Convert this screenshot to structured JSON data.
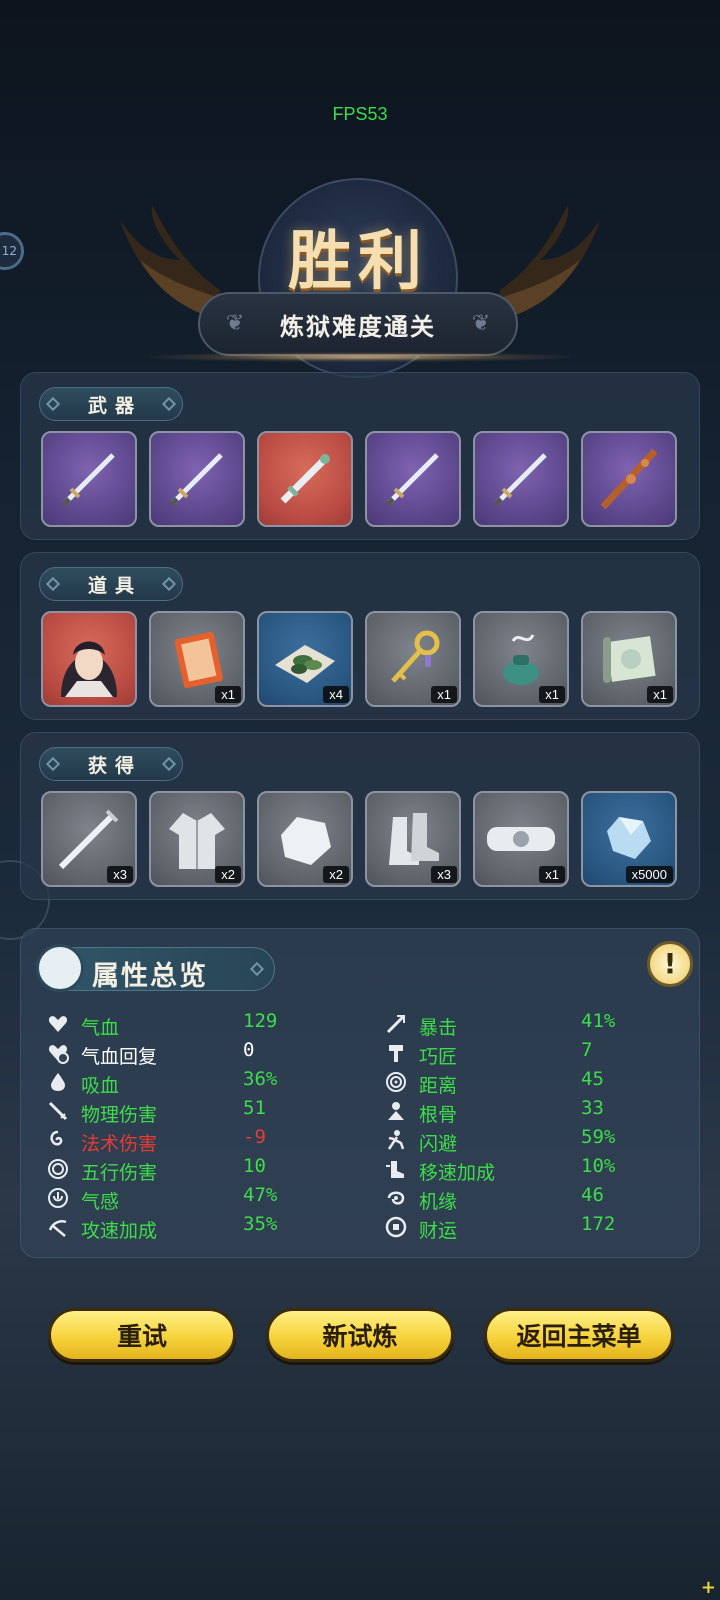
{
  "fps": "FPS53",
  "side_badge": "12",
  "victory": {
    "title": "胜利",
    "subtitle": "炼狱难度通关"
  },
  "weapons": {
    "label": "武器",
    "items": [
      {
        "icon": "silver-sword-icon",
        "rarity": "purple"
      },
      {
        "icon": "silver-sword-icon",
        "rarity": "purple"
      },
      {
        "icon": "jade-hilt-sword-icon",
        "rarity": "red"
      },
      {
        "icon": "silver-sword-icon",
        "rarity": "purple"
      },
      {
        "icon": "silver-sword-icon",
        "rarity": "purple"
      },
      {
        "icon": "bronze-staff-icon",
        "rarity": "purple"
      }
    ]
  },
  "props": {
    "label": "道具",
    "items": [
      {
        "icon": "character-portrait-icon",
        "rarity": "red",
        "count": ""
      },
      {
        "icon": "red-book-icon",
        "rarity": "gray",
        "count": "x1"
      },
      {
        "icon": "herb-leaves-icon",
        "rarity": "blue",
        "count": "x4"
      },
      {
        "icon": "golden-key-icon",
        "rarity": "gray",
        "count": "x1"
      },
      {
        "icon": "incense-burner-icon",
        "rarity": "gray",
        "count": "x1"
      },
      {
        "icon": "scroll-icon",
        "rarity": "gray",
        "count": "x1"
      }
    ]
  },
  "obtained": {
    "label": "获得",
    "items": [
      {
        "icon": "white-sword-icon",
        "rarity": "gray",
        "count": "x3"
      },
      {
        "icon": "robe-icon",
        "rarity": "gray",
        "count": "x2"
      },
      {
        "icon": "white-stone-icon",
        "rarity": "gray",
        "count": "x2"
      },
      {
        "icon": "boots-icon",
        "rarity": "gray",
        "count": "x3"
      },
      {
        "icon": "belt-icon",
        "rarity": "gray",
        "count": "x1"
      },
      {
        "icon": "crystal-icon",
        "rarity": "blue",
        "count": "x5000"
      }
    ]
  },
  "attributes": {
    "title": "属性总览",
    "info_icon": "!",
    "left": [
      {
        "icon": "heart-icon",
        "name": "气血",
        "value": "129",
        "color": "green"
      },
      {
        "icon": "heart-regen-icon",
        "name": "气血回复",
        "value": "0",
        "color": "white"
      },
      {
        "icon": "drop-icon",
        "name": "吸血",
        "value": "36%",
        "color": "green"
      },
      {
        "icon": "blade-icon",
        "name": "物理伤害",
        "value": "51",
        "color": "green"
      },
      {
        "icon": "swirl-icon",
        "name": "法术伤害",
        "value": "-9",
        "color": "red"
      },
      {
        "icon": "spiral-icon",
        "name": "五行伤害",
        "value": "10",
        "color": "green"
      },
      {
        "icon": "qi-icon",
        "name": "气感",
        "value": "47%",
        "color": "green"
      },
      {
        "icon": "attack-speed-icon",
        "name": "攻速加成",
        "value": "35%",
        "color": "green"
      }
    ],
    "right": [
      {
        "icon": "crit-icon",
        "name": "暴击",
        "value": "41%",
        "color": "green"
      },
      {
        "icon": "hammer-icon",
        "name": "巧匠",
        "value": "7",
        "color": "green"
      },
      {
        "icon": "range-icon",
        "name": "距离",
        "value": "45",
        "color": "green"
      },
      {
        "icon": "root-bone-icon",
        "name": "根骨",
        "value": "33",
        "color": "green"
      },
      {
        "icon": "dodge-icon",
        "name": "闪避",
        "value": "59%",
        "color": "green"
      },
      {
        "icon": "boot-speed-icon",
        "name": "移速加成",
        "value": "10%",
        "color": "green"
      },
      {
        "icon": "luck-icon",
        "name": "机缘",
        "value": "46",
        "color": "green"
      },
      {
        "icon": "coin-icon",
        "name": "财运",
        "value": "172",
        "color": "green"
      }
    ]
  },
  "buttons": {
    "retry": "重试",
    "new_trial": "新试炼",
    "main_menu": "返回主菜单"
  },
  "corner_icon": "+"
}
